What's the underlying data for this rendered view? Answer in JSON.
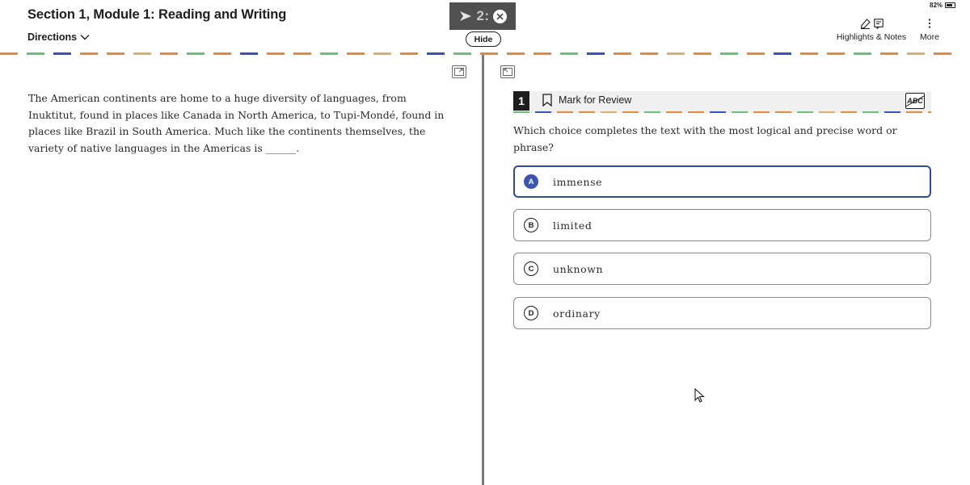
{
  "header": {
    "section_title": "Section 1, Module 1: Reading and Writing",
    "directions_label": "Directions",
    "timer_text": "2:",
    "hide_label": "Hide",
    "battery_text": "82%",
    "highlights_label": "Highlights & Notes",
    "more_label": "More"
  },
  "passage": {
    "text": "The American continents are home to a huge diversity of languages, from Inuktitut, found in places like Canada in North America, to Tupi-Mondé, found in places like Brazil in South America. Much like the continents themselves, the variety of native languages in the Americas is ______."
  },
  "question": {
    "number": "1",
    "mark_for_review_label": "Mark for Review",
    "abc_label": "ABC",
    "prompt": "Which choice completes the text with the most logical and precise word or phrase?",
    "choices": [
      {
        "letter": "A",
        "text": "immense",
        "selected": true
      },
      {
        "letter": "B",
        "text": "limited",
        "selected": false
      },
      {
        "letter": "C",
        "text": "unknown",
        "selected": false
      },
      {
        "letter": "D",
        "text": "ordinary",
        "selected": false
      }
    ]
  },
  "colors": {
    "accent_blue": "#3b55b0",
    "selected_border": "#2d4aa0",
    "dash_orange": "#e38b3a",
    "dash_green": "#6cc17a",
    "dash_blue": "#3a4fc0",
    "dash_tan": "#d8b06e"
  }
}
